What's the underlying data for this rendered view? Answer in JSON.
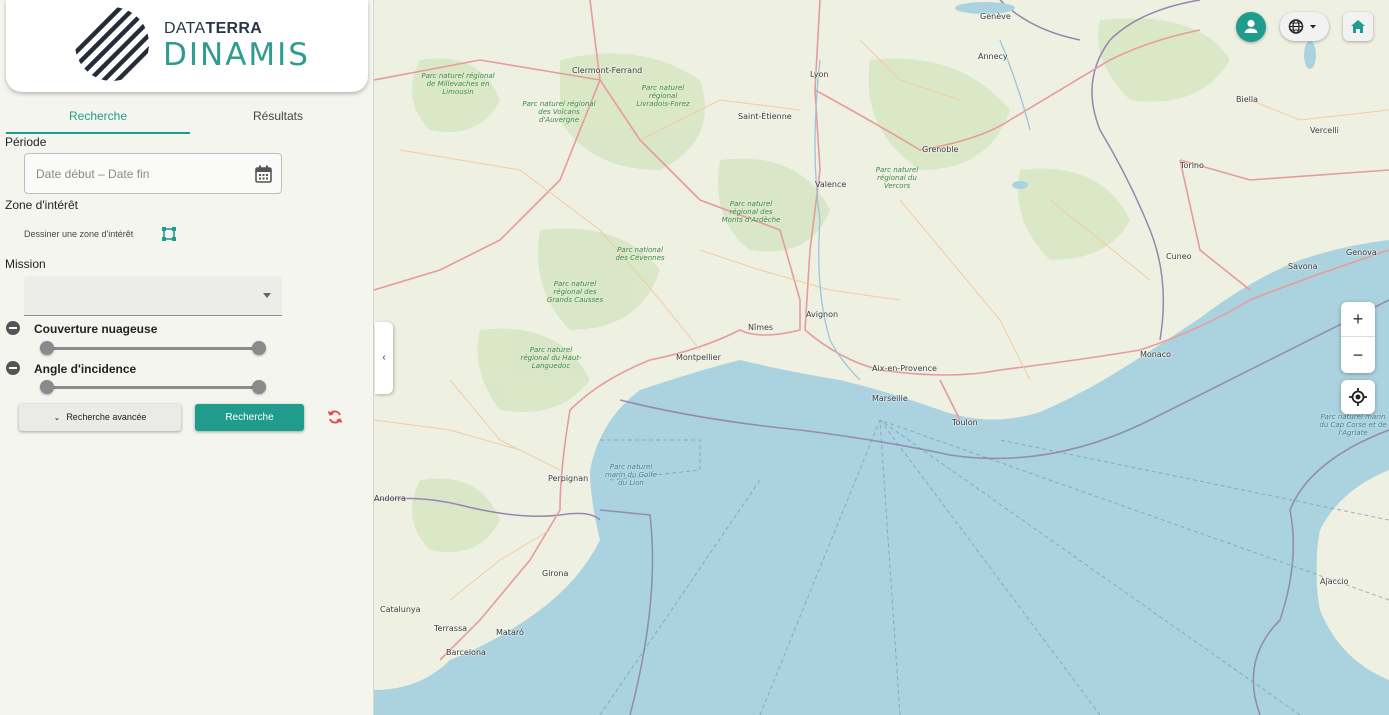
{
  "brand": {
    "top_light": "DATA",
    "top_bold": "TERRA",
    "main": "DINAMIS"
  },
  "tabs": [
    {
      "label": "Recherche",
      "active": true
    },
    {
      "label": "Résultats",
      "active": false
    }
  ],
  "form": {
    "period_label": "Période",
    "date_placeholder": "Date début – Date fin",
    "zone_label": "Zone d'intérêt",
    "draw_label": "Dessiner une zone d'intérêt",
    "mission_label": "Mission",
    "mission_value": "",
    "cloud_label": "Couverture nuageuse",
    "cloud_range_fraction": [
      0,
      1
    ],
    "incidence_label": "Angle d'incidence",
    "incidence_range_fraction": [
      0,
      1
    ],
    "advanced_label": "Recherche avancée",
    "search_label": "Recherche"
  },
  "map": {
    "zoom_in_label": "+",
    "zoom_out_label": "−",
    "cities": [
      "Genève",
      "Annecy",
      "Clermont-Ferrand",
      "Lyon",
      "Saint-Étienne",
      "Grenoble",
      "Valence",
      "Torino",
      "Cuneo",
      "Savona",
      "Genova",
      "Nîmes",
      "Montpellier",
      "Avignon",
      "Aix-en-Provence",
      "Marseille",
      "Toulon",
      "Monaco",
      "Perpignan",
      "Andorra",
      "Girona",
      "Barcelona",
      "Mataró",
      "Terrassa",
      "Catalunya",
      "Ajaccio",
      "Biella",
      "Vercelli"
    ],
    "parks": [
      "Parc naturel régional de Millevaches en Limousin",
      "Parc naturel régional des Volcans d'Auvergne",
      "Parc naturel régional Livradois-Forez",
      "Parc naturel régional des Monts d'Ardèche",
      "Parc naturel régional des Grands Causses",
      "Parc naturel régional du Haut-Languedoc",
      "Parc naturel régional du Vercors",
      "Parc naturel marin du Golfe du Lion",
      "Parc naturel marin du Cap Corse et de l'Agriate",
      "Parc national des Cévennes"
    ],
    "sea_labels": []
  },
  "colors": {
    "accent": "#1f9c8c",
    "reset": "#e04a3f",
    "sea": "#aad3df",
    "land": "#eef0e2"
  },
  "icons": {
    "calendar": "calendar-icon",
    "draw": "bounding-box-icon",
    "user": "user-icon",
    "language": "globe-icon",
    "home": "home-icon",
    "locate": "crosshair-icon",
    "reset": "refresh-icon",
    "collapse": "chevron-left-icon"
  }
}
